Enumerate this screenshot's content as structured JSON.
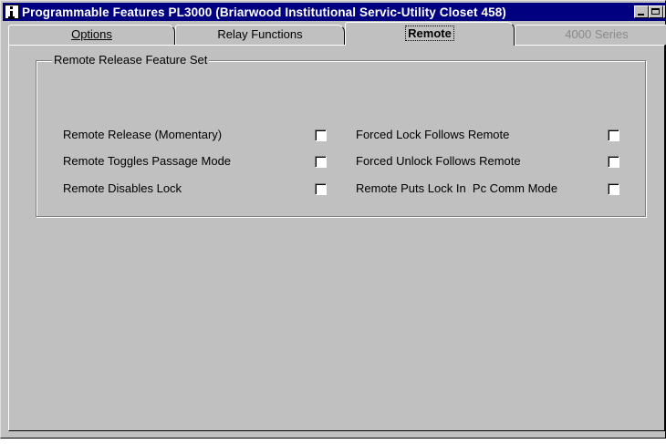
{
  "window": {
    "title": "Programmable Features PL3000 (Briarwood Institutional Servic-Utility Closet 458)",
    "icon": "app-info-icon",
    "controls": {
      "minimize": "minimize-icon",
      "maximize": "maximize-icon",
      "close_glyph": "✕"
    }
  },
  "tabs": [
    {
      "label": "Options",
      "state": "normal"
    },
    {
      "label": "Relay Functions",
      "state": "normal"
    },
    {
      "label": "Remote",
      "state": "selected"
    },
    {
      "label": "4000 Series",
      "state": "disabled"
    }
  ],
  "group": {
    "title": "Remote Release Feature Set",
    "left_options": [
      {
        "label": "Remote Release (Momentary)",
        "checked": false
      },
      {
        "label": "Remote Toggles Passage Mode",
        "checked": false
      },
      {
        "label": "Remote Disables Lock",
        "checked": false
      }
    ],
    "right_options": [
      {
        "label": "Forced Lock Follows Remote",
        "checked": false
      },
      {
        "label": "Forced Unlock Follows Remote",
        "checked": false
      },
      {
        "label": "Remote Puts Lock In  Pc Comm Mode",
        "checked": false
      }
    ]
  },
  "colors": {
    "titlebar": "#000080",
    "face": "#c0c0c0",
    "disabled_text": "#8a8a8a"
  }
}
